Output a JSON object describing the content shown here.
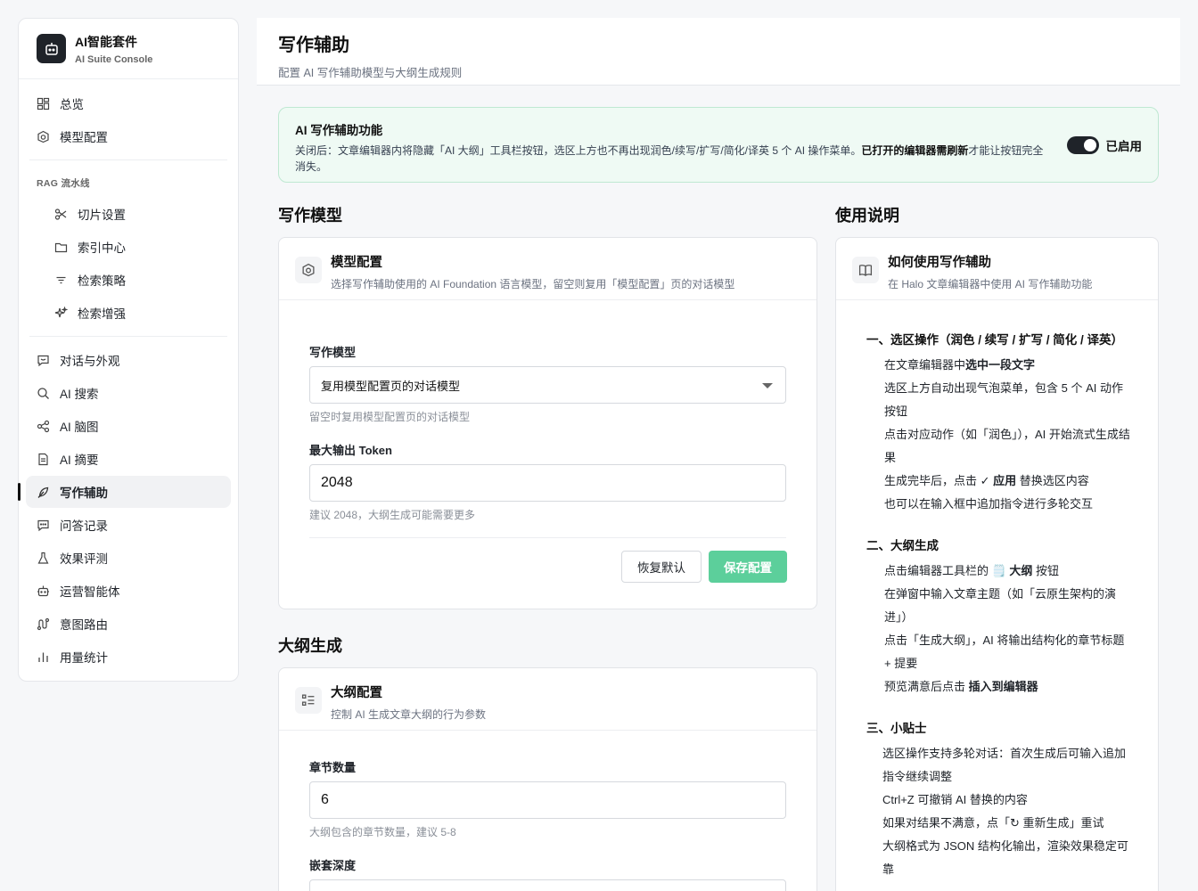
{
  "brand": {
    "title": "AI智能套件",
    "subtitle": "AI Suite Console"
  },
  "nav": {
    "overview": "总览",
    "model_config": "模型配置",
    "rag_group": "RAG 流水线",
    "chunk": "切片设置",
    "index": "索引中心",
    "retrieval": "检索策略",
    "enhance": "检索增强",
    "chat": "对话与外观",
    "search": "AI 搜索",
    "mindmap": "AI 脑图",
    "summary": "AI 摘要",
    "writing": "写作辅助",
    "qa": "问答记录",
    "eval": "效果评测",
    "agent": "运营智能体",
    "router": "意图路由",
    "usage": "用量统计"
  },
  "header": {
    "title": "写作辅助",
    "subtitle": "配置 AI 写作辅助模型与大纲生成规则"
  },
  "banner": {
    "title": "AI 写作辅助功能",
    "desc_before": "关闭后：文章编辑器内将隐藏「AI 大纲」工具栏按钮，选区上方也不再出现润色/续写/扩写/简化/译英 5 个 AI 操作菜单。",
    "desc_bold": "已打开的编辑器需刷新",
    "desc_after": "才能让按钮完全消失。",
    "toggle_on": true,
    "toggle_label": "已启用"
  },
  "writing_model": {
    "section_title": "写作模型",
    "card_title": "模型配置",
    "card_sub": "选择写作辅助使用的 AI Foundation 语言模型，留空则复用「模型配置」页的对话模型",
    "model_label": "写作模型",
    "model_value": "复用模型配置页的对话模型",
    "model_hint": "留空时复用模型配置页的对话模型",
    "token_label": "最大输出 Token",
    "token_value": "2048",
    "token_hint": "建议 2048，大纲生成可能需要更多",
    "reset_label": "恢复默认",
    "save_label": "保存配置"
  },
  "outline": {
    "section_title": "大纲生成",
    "card_title": "大纲配置",
    "card_sub": "控制 AI 生成文章大纲的行为参数",
    "chapters_label": "章节数量",
    "chapters_value": "6",
    "chapters_hint": "大纲包含的章节数量，建议 5-8",
    "depth_label": "嵌套深度"
  },
  "guide": {
    "section_title": "使用说明",
    "card_title": "如何使用写作辅助",
    "card_sub": "在 Halo 文章编辑器中使用 AI 写作辅助功能",
    "h1": "一、选区操作（润色 / 续写 / 扩写 / 简化 / 译英）",
    "s1_1a": "在文章编辑器中",
    "s1_1b": "选中一段文字",
    "s1_2": "选区上方自动出现气泡菜单，包含 5 个 AI 动作按钮",
    "s1_3": "点击对应动作（如「润色」），AI 开始流式生成结果",
    "s1_4a": "生成完毕后，点击 ",
    "s1_4b": "✓ 应用",
    "s1_4c": " 替换选区内容",
    "s1_5": "也可以在输入框中追加指令进行多轮交互",
    "h2": "二、大纲生成",
    "s2_1a": "点击编辑器工具栏的 ",
    "s2_1b": "🗒️ 大纲",
    "s2_1c": " 按钮",
    "s2_2": "在弹窗中输入文章主题（如「云原生架构的演进」）",
    "s2_3": "点击「生成大纲」，AI 将输出结构化的章节标题 + 提要",
    "s2_4a": "预览满意后点击 ",
    "s2_4b": "插入到编辑器",
    "h3": "三、小贴士",
    "s3_1": "选区操作支持多轮对话：首次生成后可输入追加指令继续调整",
    "s3_2": "Ctrl+Z 可撤销 AI 替换的内容",
    "s3_3": "如果对结果不满意，点「↻ 重新生成」重试",
    "s3_4": "大纲格式为 JSON 结构化输出，渲染效果稳定可靠"
  },
  "colors": {
    "primary": "#5ccf9b",
    "banner_bg": "#effaf4",
    "dark": "#1f2329"
  }
}
